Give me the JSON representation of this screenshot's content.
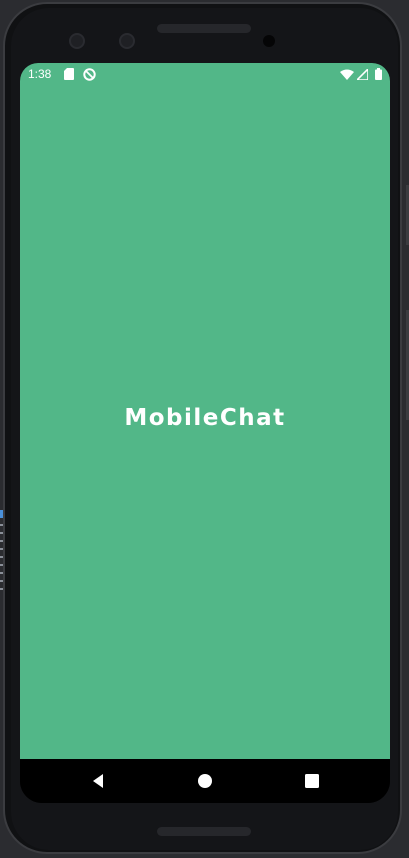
{
  "status_bar": {
    "time": "1:38",
    "icons": [
      "sd-card-icon",
      "no-disturb-icon",
      "wifi-icon",
      "signal-icon",
      "battery-icon"
    ]
  },
  "app": {
    "title": "MobileChat",
    "background_color": "#52b788",
    "title_color": "#ffffff"
  },
  "nav_bar": {
    "buttons": [
      "back-icon",
      "home-icon",
      "recents-icon"
    ]
  }
}
